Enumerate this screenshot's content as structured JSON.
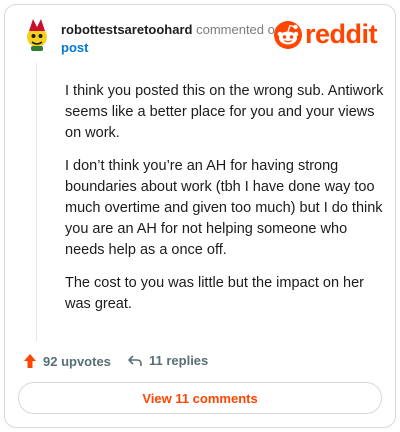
{
  "comment": {
    "username": "robottestsaretoohard",
    "action_text": "commented on",
    "post_link": "post",
    "brand": "reddit",
    "brand_color": "#ff4500",
    "paragraphs": [
      "I think you posted this on the wrong sub. Antiwork seems like a better place for you and your views on work.",
      "I don’t think you’re an AH for having strong boundaries about work (tbh I have done way too much overtime and given too much) but I do think you are an AH for not helping someone who needs help as a once off.",
      "The cost to you was little but the impact on her was great."
    ]
  },
  "footer": {
    "upvotes_label": "92 upvotes",
    "upvote_icon": "upvote-arrow-icon",
    "replies_label": "11 replies",
    "reply_icon": "reply-arrow-icon",
    "view_comments_label": "View 11 comments"
  }
}
